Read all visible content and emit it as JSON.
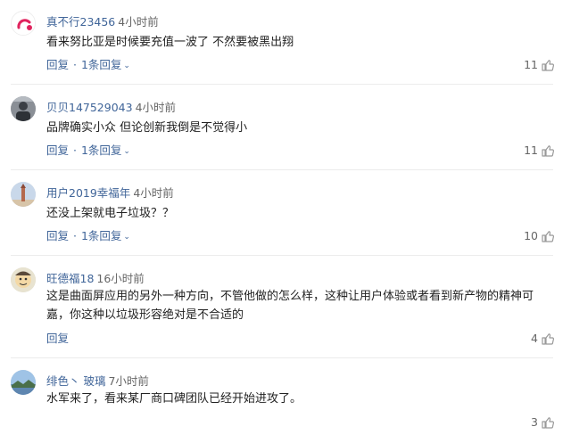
{
  "labels": {
    "reply": "回复",
    "separator": "·",
    "chevron": "⌄"
  },
  "comments": [
    {
      "username": "真不行23456",
      "time": "4小时前",
      "text": "看来努比亚是时候要充值一波了 不然要被黑出翔",
      "replies": "1条回复",
      "likes": "11",
      "avatar_icon": "pink-logo-avatar"
    },
    {
      "username": "贝贝147529043",
      "time": "4小时前",
      "text": "品牌确实小众 但论创新我倒是不觉得小",
      "replies": "1条回复",
      "likes": "11",
      "avatar_icon": "photo-avatar"
    },
    {
      "username": "用户2019幸福年",
      "time": "4小时前",
      "text": "还没上架就电子垃圾？？",
      "replies": "1条回复",
      "likes": "10",
      "avatar_icon": "tower-avatar"
    },
    {
      "username": "旺德福18",
      "time": "16小时前",
      "text": "这是曲面屏应用的另外一种方向，不管他做的怎么样，这种让用户体验或者看到新产物的精神可嘉，你这种以垃圾形容绝对是不合适的",
      "replies": "",
      "likes": "4",
      "avatar_icon": "cartoon-avatar"
    },
    {
      "username": "绯色丶 玻璃",
      "time": "7小时前",
      "text": "水军来了，看来某厂商口碑团队已经开始进攻了。",
      "replies": "",
      "likes": "3",
      "avatar_icon": "landscape-avatar"
    }
  ],
  "colors": {
    "link": "#406599",
    "meta": "#666666",
    "text": "#222222",
    "divider": "#ececec"
  }
}
